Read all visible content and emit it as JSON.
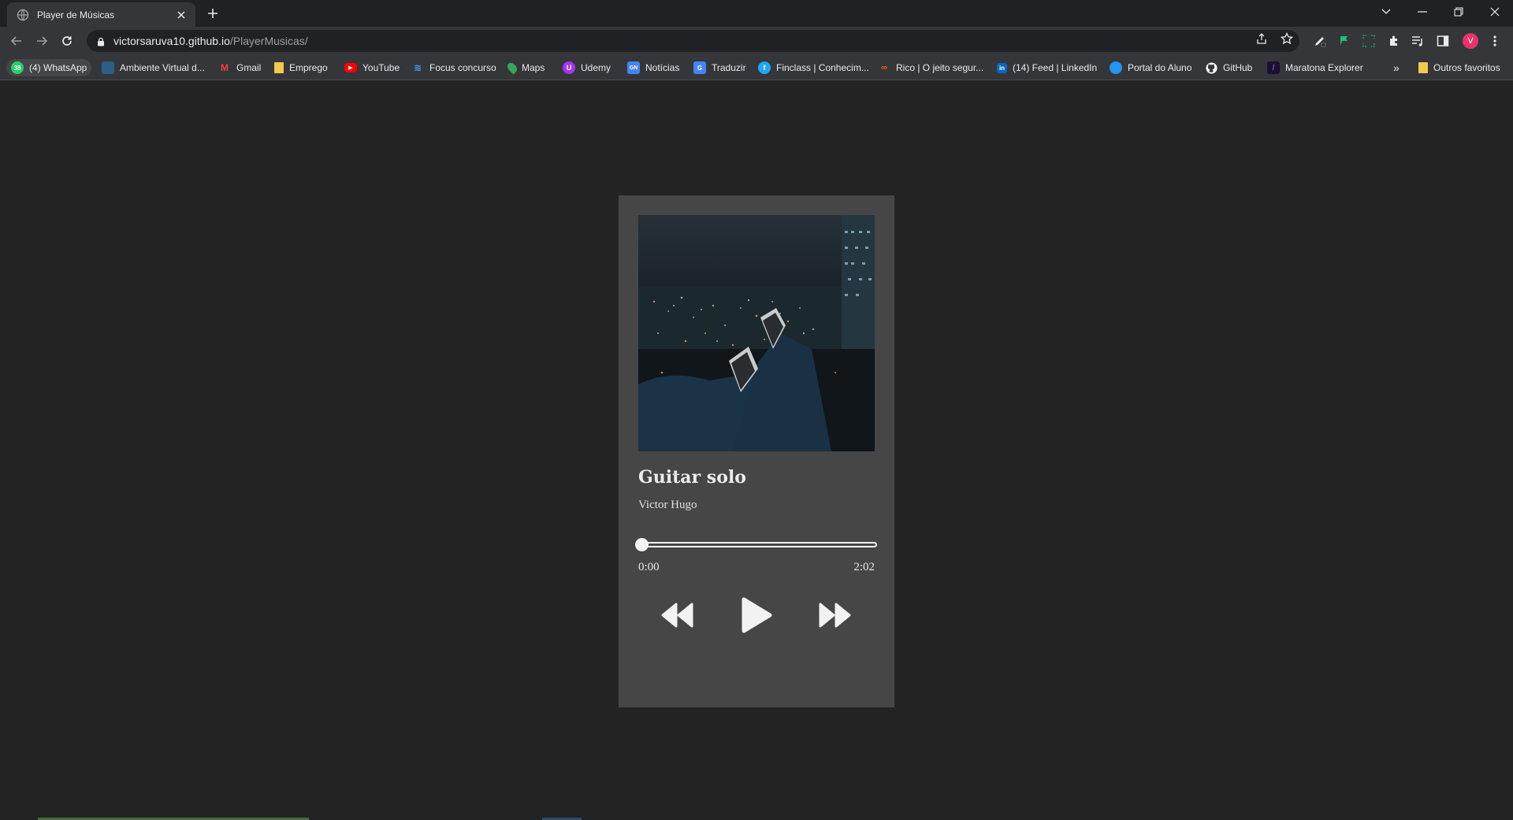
{
  "browser": {
    "tab": {
      "title": "Player de Músicas"
    },
    "url": {
      "host": "victorsaruva10.github.io",
      "path": "/PlayerMusicas/"
    },
    "profile_initial": "V",
    "bookmarks": [
      {
        "label": "(4) WhatsApp",
        "icon": "whatsapp-icon",
        "color": "#25d366"
      },
      {
        "label": "Ambiente Virtual d...",
        "icon": "ava-icon",
        "color": "#2b5f8a"
      },
      {
        "label": "Gmail",
        "icon": "gmail-icon",
        "color": "#ea4335"
      },
      {
        "label": "Emprego",
        "icon": "folder-icon",
        "color": "#f2c94c"
      },
      {
        "label": "YouTube",
        "icon": "youtube-icon",
        "color": "#ff0000"
      },
      {
        "label": "Focus concurso",
        "icon": "focus-icon",
        "color": "#4aa3ff"
      },
      {
        "label": "Maps",
        "icon": "maps-icon",
        "color": "#34a853"
      },
      {
        "label": "Udemy",
        "icon": "udemy-icon",
        "color": "#a435f0"
      },
      {
        "label": "Notícias",
        "icon": "news-icon",
        "color": "#4285f4"
      },
      {
        "label": "Traduzir",
        "icon": "translate-icon",
        "color": "#4285f4"
      },
      {
        "label": "Finclass | Conhecim...",
        "icon": "finclass-icon",
        "color": "#1ea7fd"
      },
      {
        "label": "Rico | O jeito segur...",
        "icon": "rico-icon",
        "color": "#ff5a00"
      },
      {
        "label": "(14) Feed | LinkedIn",
        "icon": "linkedin-icon",
        "color": "#0a66c2"
      },
      {
        "label": "Portal do Aluno",
        "icon": "portal-icon",
        "color": "#2196f3"
      },
      {
        "label": "GitHub",
        "icon": "github-icon",
        "color": "#ffffff"
      },
      {
        "label": "Maratona Explorer",
        "icon": "maratona-icon",
        "color": "#8257e5"
      }
    ],
    "other_bookmarks": "Outros favoritos",
    "overflow_label": "»"
  },
  "player": {
    "title": "Guitar solo",
    "artist": "Victor Hugo",
    "current_time": "0:00",
    "duration": "2:02",
    "progress_fraction": 0.0
  },
  "colors": {
    "page_bg": "#232323",
    "card_bg": "#464646",
    "text": "#ececec"
  }
}
